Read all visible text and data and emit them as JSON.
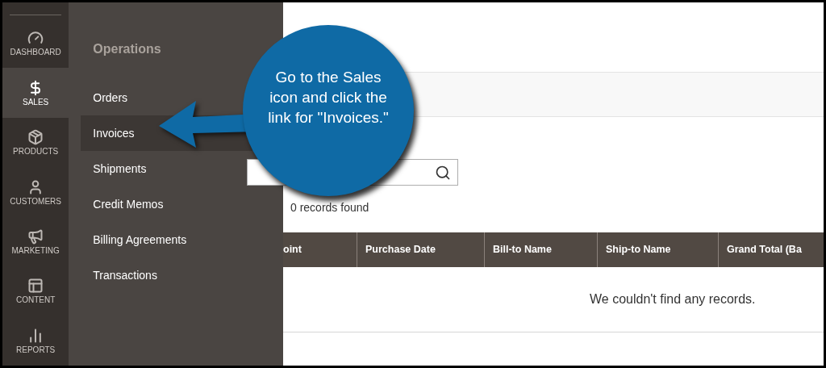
{
  "rail": [
    {
      "label": "DASHBOARD",
      "selected": false
    },
    {
      "label": "SALES",
      "selected": true
    },
    {
      "label": "PRODUCTS",
      "selected": false
    },
    {
      "label": "CUSTOMERS",
      "selected": false
    },
    {
      "label": "MARKETING",
      "selected": false
    },
    {
      "label": "CONTENT",
      "selected": false
    },
    {
      "label": "REPORTS",
      "selected": false
    }
  ],
  "flyout": {
    "title": "Operations",
    "items": [
      {
        "label": "Orders",
        "selected": false
      },
      {
        "label": "Invoices",
        "selected": true
      },
      {
        "label": "Shipments",
        "selected": false
      },
      {
        "label": "Credit Memos",
        "selected": false
      },
      {
        "label": "Billing Agreements",
        "selected": false
      },
      {
        "label": "Transactions",
        "selected": false
      }
    ]
  },
  "main": {
    "records_found": "0 records found",
    "table": {
      "columns": [
        "oint",
        "Purchase Date",
        "Bill-to Name",
        "Ship-to Name",
        "Grand Total (Ba"
      ],
      "empty_message": "We couldn't find any records."
    }
  },
  "callout": {
    "text": "Go to the Sales icon and click the link for \"Invoices.\""
  }
}
